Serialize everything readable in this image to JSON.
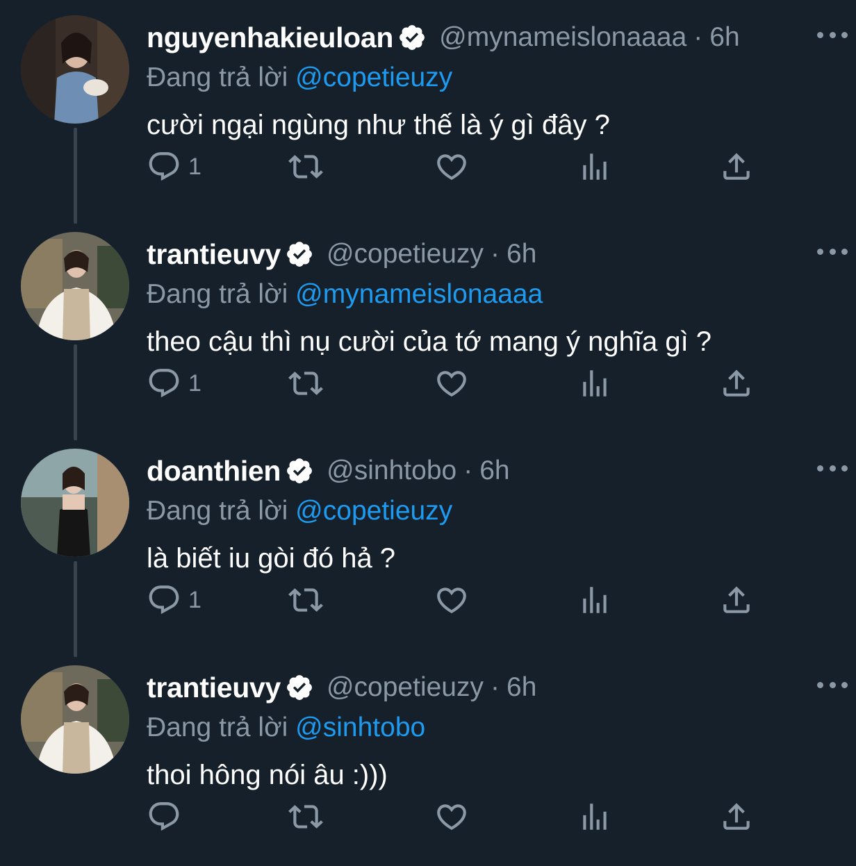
{
  "tweets": [
    {
      "display_name": "nguyenhakieuloan",
      "handle": "@mynameislonaaaa",
      "dot": "·",
      "time": "6h",
      "replying_prefix": "Đang trả lời",
      "replying_to": "@copetieuzy",
      "text": "cười ngại ngùng như thế là ý gì đây ?",
      "reply_count": "1",
      "avatar_icon": "profile-photo"
    },
    {
      "display_name": "trantieuvy",
      "handle": "@copetieuzy",
      "dot": "·",
      "time": "6h",
      "replying_prefix": "Đang trả lời",
      "replying_to": "@mynameislonaaaa",
      "text": "theo cậu thì nụ cười của tớ mang ý nghĩa gì ?",
      "reply_count": "1",
      "avatar_icon": "profile-photo"
    },
    {
      "display_name": "doanthien",
      "handle": "@sinhtobo",
      "dot": "·",
      "time": "6h",
      "replying_prefix": "Đang trả lời",
      "replying_to": "@copetieuzy",
      "text": "là biết iu gòi đó hả ?",
      "reply_count": "1",
      "avatar_icon": "profile-photo"
    },
    {
      "display_name": "trantieuvy",
      "handle": "@copetieuzy",
      "dot": "·",
      "time": "6h",
      "replying_prefix": "Đang trả lời",
      "replying_to": "@sinhtobo",
      "text": "thoi hông nói âu :)))",
      "reply_count": "",
      "avatar_icon": "profile-photo"
    }
  ],
  "icons": {
    "verified": "verified-badge-icon",
    "more": "more-options-icon",
    "reply": "reply-icon",
    "retweet": "retweet-icon",
    "like": "heart-icon",
    "views": "views-icon",
    "share": "share-icon"
  },
  "colors": {
    "background": "#15202b",
    "muted": "#8b98a5",
    "link": "#1d9bf0",
    "thread_line": "#38444d"
  }
}
